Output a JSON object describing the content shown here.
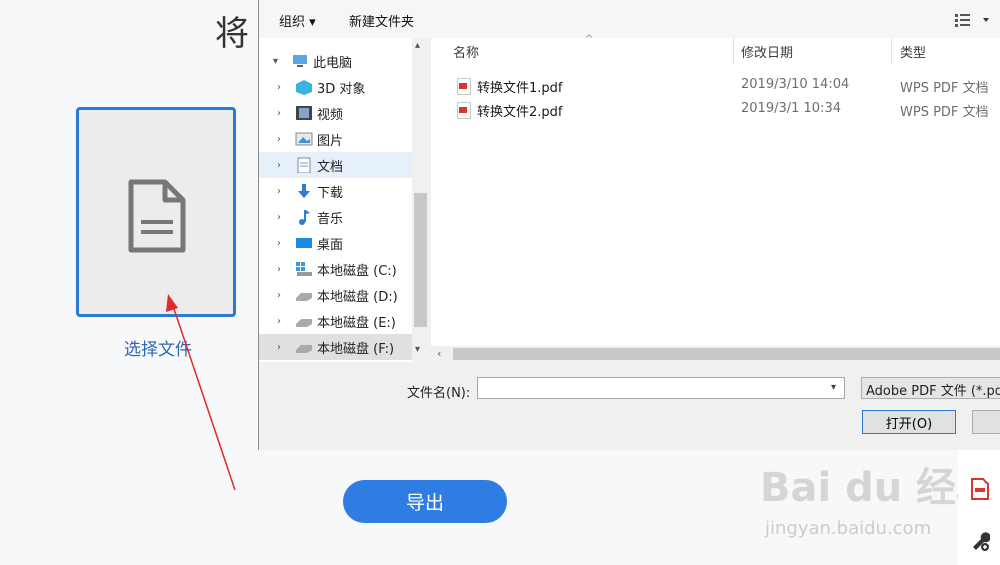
{
  "app": {
    "title_partial": "将",
    "select_file_label": "选择文件",
    "export_label": "导出",
    "watermark": "Bai du 经验",
    "watermark_sub": "jingyan.baidu.com"
  },
  "dialog": {
    "toolbar": {
      "organize": "组织 ▾",
      "new_folder": "新建文件夹"
    },
    "nav": {
      "root": "此电脑",
      "items": [
        {
          "label": "3D 对象",
          "icon": "3d-objects-icon"
        },
        {
          "label": "视频",
          "icon": "video-icon"
        },
        {
          "label": "图片",
          "icon": "pictures-icon"
        },
        {
          "label": "文档",
          "icon": "documents-icon",
          "selected": true
        },
        {
          "label": "下载",
          "icon": "download-icon"
        },
        {
          "label": "音乐",
          "icon": "music-icon"
        },
        {
          "label": "桌面",
          "icon": "desktop-icon"
        },
        {
          "label": "本地磁盘 (C:)",
          "icon": "drive-c-icon"
        },
        {
          "label": "本地磁盘 (D:)",
          "icon": "drive-icon"
        },
        {
          "label": "本地磁盘 (E:)",
          "icon": "drive-icon"
        },
        {
          "label": "本地磁盘 (F:)",
          "icon": "drive-icon"
        }
      ]
    },
    "columns": {
      "name": "名称",
      "modified": "修改日期",
      "type": "类型"
    },
    "files": [
      {
        "name": "转换文件1.pdf",
        "modified": "2019/3/10 14:04",
        "type": "WPS PDF 文档"
      },
      {
        "name": "转换文件2.pdf",
        "modified": "2019/3/1 10:34",
        "type": "WPS PDF 文档"
      }
    ],
    "filename_label": "文件名(N):",
    "filename_value": "",
    "filetype_value": "Adobe PDF 文件 (*.pd",
    "open_label": "打开(O)",
    "colors": {
      "accent": "#2a7bd1",
      "selected_bg": "#e5f0fb"
    }
  }
}
